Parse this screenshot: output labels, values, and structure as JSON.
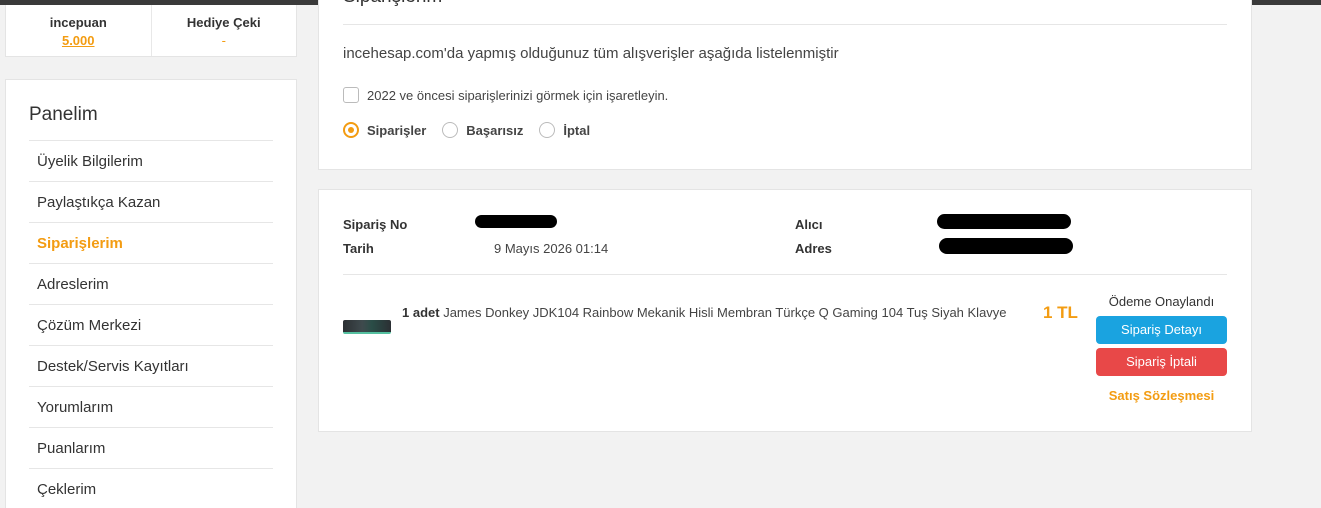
{
  "points": {
    "incepuan_label": "incepuan",
    "incepuan_value": "5.000",
    "gift_label": "Hediye Çeki",
    "gift_value": "-"
  },
  "sidebar": {
    "title": "Panelim",
    "items": [
      {
        "label": "Üyelik Bilgilerim"
      },
      {
        "label": "Paylaştıkça Kazan"
      },
      {
        "label": "Siparişlerim"
      },
      {
        "label": "Adreslerim"
      },
      {
        "label": "Çözüm Merkezi"
      },
      {
        "label": "Destek/Servis Kayıtları"
      },
      {
        "label": "Yorumlarım"
      },
      {
        "label": "Puanlarım"
      },
      {
        "label": "Çeklerim"
      }
    ],
    "active_index": 2
  },
  "orders": {
    "title": "Siparişlerim",
    "intro": "incehesap.com'da yapmış olduğunuz tüm alışverişler aşağıda listelenmiştir",
    "checkbox_label": "2022 ve öncesi siparişlerinizi görmek için işaretleyin.",
    "filters": [
      {
        "label": "Siparişler",
        "checked": true
      },
      {
        "label": "Başarısız",
        "checked": false
      },
      {
        "label": "İptal",
        "checked": false
      }
    ]
  },
  "order": {
    "order_no_label": "Sipariş No",
    "date_label": "Tarih",
    "date_value": "9 Mayıs 2026 01:14",
    "recipient_label": "Alıcı",
    "address_label": "Adres",
    "quantity": "1 adet",
    "product_name": "James Donkey JDK104 Rainbow Mekanik Hisli Membran Türkçe Q Gaming 104 Tuş Siyah Klavye",
    "price": "1 TL",
    "status": "Ödeme Onaylandı",
    "detail_button": "Sipariş Detayı",
    "cancel_button": "Sipariş İptali",
    "contract_link": "Satış Sözleşmesi"
  },
  "colors": {
    "accent": "#f39c12",
    "detail_button": "#1aa3e0",
    "cancel_button": "#e84848"
  },
  "icons": [
    "keyboard-product-image"
  ]
}
